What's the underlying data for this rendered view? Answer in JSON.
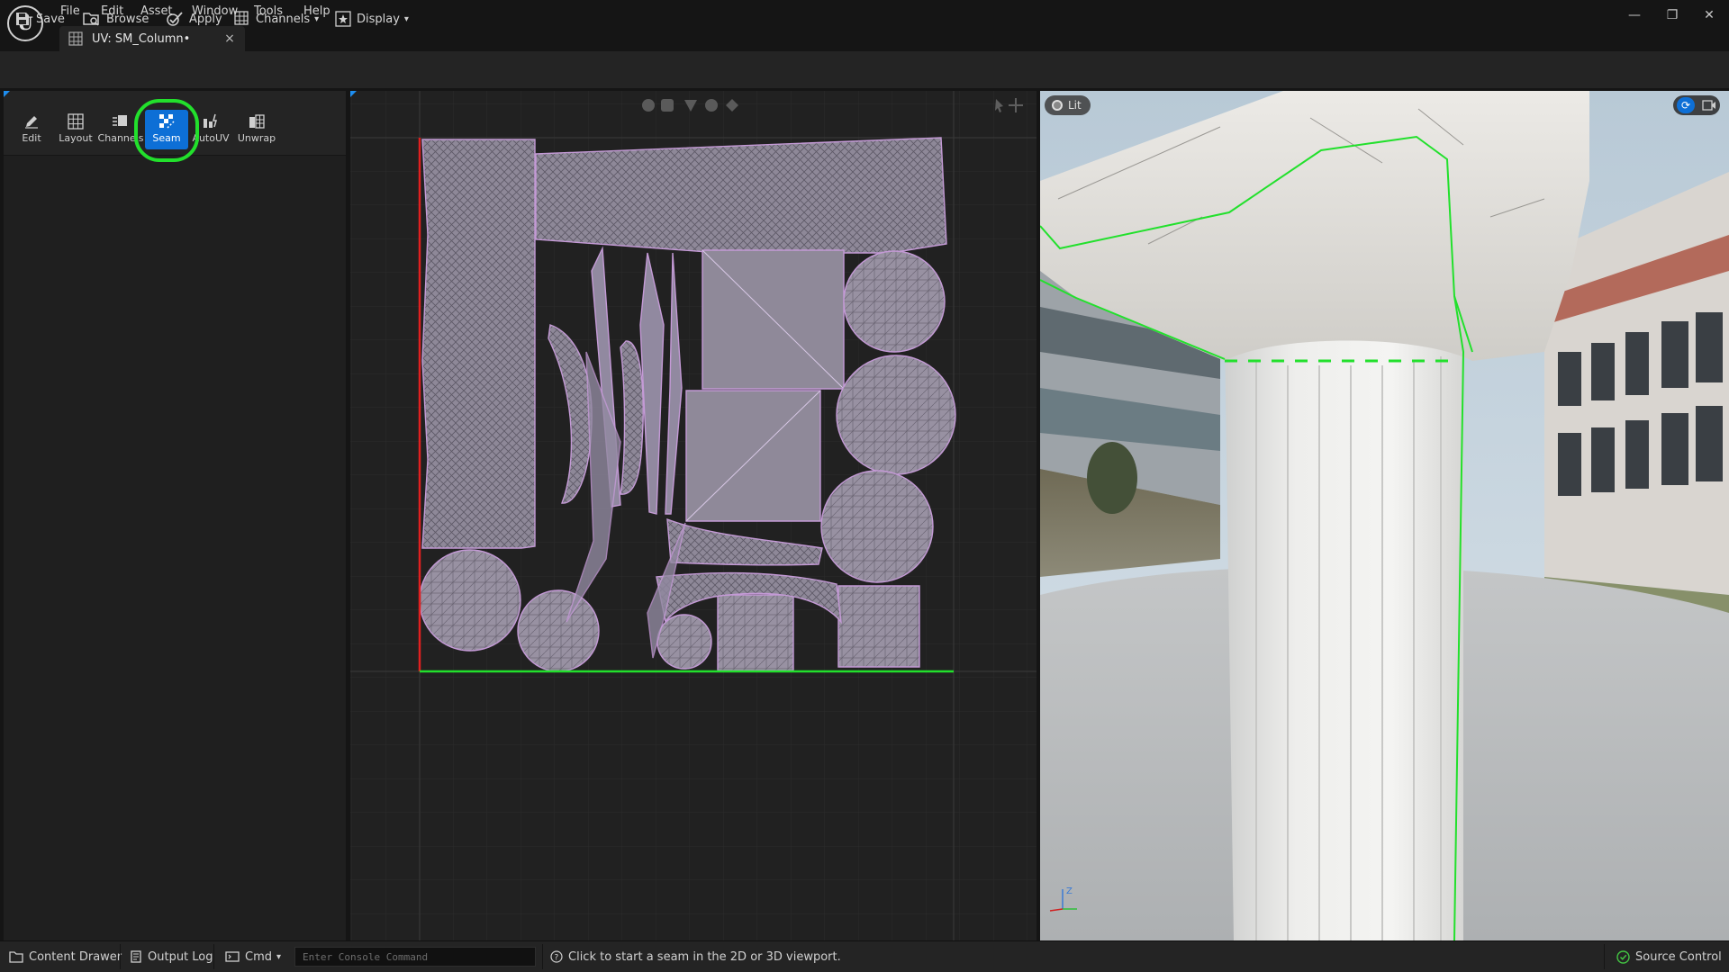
{
  "app": {
    "logo_letter": "U",
    "menu": [
      "File",
      "Edit",
      "Asset",
      "Window",
      "Tools",
      "Help"
    ]
  },
  "tab": {
    "title": "UV: SM_Column•",
    "close": "×"
  },
  "window_controls": {
    "minimize": "—",
    "restore": "❐",
    "close": "✕"
  },
  "toolbar": {
    "save": "Save",
    "browse": "Browse",
    "apply": "Apply",
    "channels": "Channels",
    "display": "Display"
  },
  "tools": [
    {
      "label": "Edit"
    },
    {
      "label": "Layout"
    },
    {
      "label": "Channels"
    },
    {
      "label": "Seam"
    },
    {
      "label": "AutoUV"
    },
    {
      "label": "Unwrap"
    }
  ],
  "active_tool": "Seam",
  "viewport3d": {
    "lit_label": "Lit",
    "axis_z": "Z"
  },
  "statusbar": {
    "content_drawer": "Content Drawer",
    "output_log": "Output Log",
    "cmd": "Cmd",
    "console_placeholder": "Enter Console Command",
    "hint": "Click to start a seam in the 2D or 3D viewport.",
    "source_control": "Source Control"
  },
  "colors": {
    "accent": "#0d6fd6",
    "highlight": "#22e02c",
    "seam": "#22e02c",
    "uv_wire": "#c49ad6",
    "uv_fill": "#9a93a4",
    "uv_axis_v": "#e02020"
  }
}
